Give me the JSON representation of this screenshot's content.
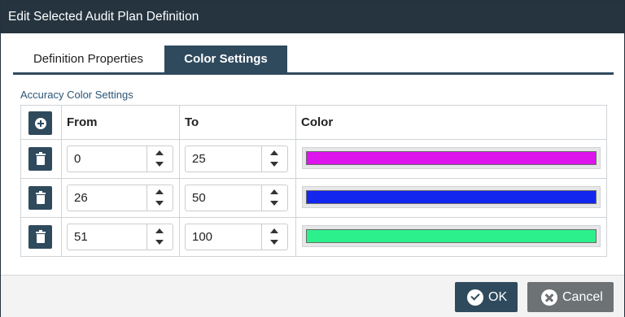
{
  "dialog": {
    "title": "Edit Selected Audit Plan Definition"
  },
  "tabs": [
    {
      "label": "Definition Properties",
      "active": false
    },
    {
      "label": "Color Settings",
      "active": true
    }
  ],
  "section": {
    "title": "Accuracy Color Settings"
  },
  "table": {
    "add_icon": "plus-circle-icon",
    "delete_icon": "trash-icon",
    "columns": [
      "From",
      "To",
      "Color"
    ],
    "rows": [
      {
        "from": "0",
        "to": "25",
        "color": "#dd14ee"
      },
      {
        "from": "26",
        "to": "50",
        "color": "#1226ee"
      },
      {
        "from": "51",
        "to": "100",
        "color": "#2cf08c"
      }
    ]
  },
  "footer": {
    "ok_label": "OK",
    "ok_icon": "check-circle-icon",
    "cancel_label": "Cancel",
    "cancel_icon": "x-circle-icon"
  },
  "colors": {
    "titlebar": "#25343f",
    "accent": "#2f4a5d",
    "cancel": "#6d7275"
  }
}
